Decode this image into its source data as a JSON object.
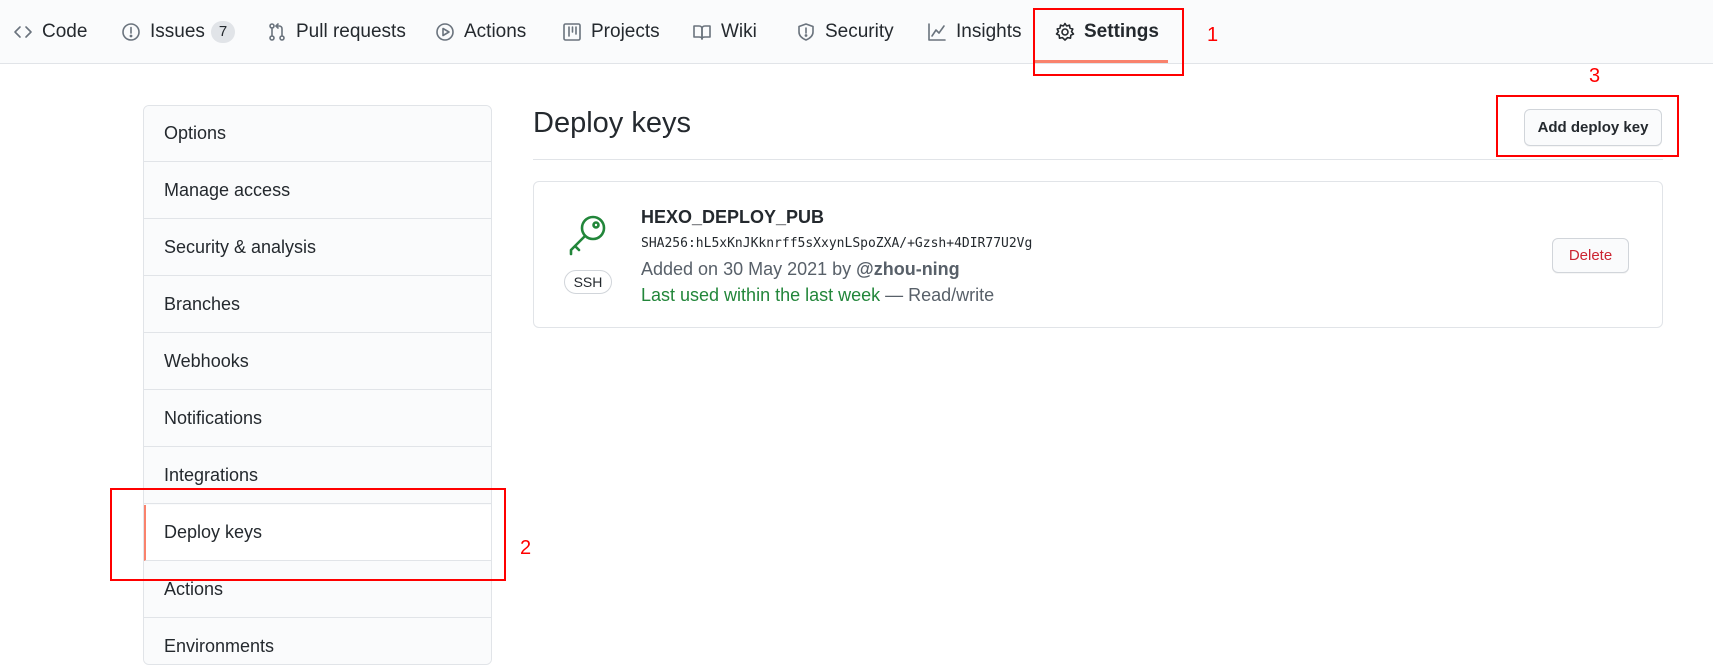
{
  "nav": {
    "tabs": [
      {
        "label": "Code",
        "icon": "code-icon"
      },
      {
        "label": "Issues",
        "icon": "issue-icon",
        "count": "7"
      },
      {
        "label": "Pull requests",
        "icon": "pull-request-icon"
      },
      {
        "label": "Actions",
        "icon": "play-icon"
      },
      {
        "label": "Projects",
        "icon": "project-icon"
      },
      {
        "label": "Wiki",
        "icon": "book-icon"
      },
      {
        "label": "Security",
        "icon": "shield-icon"
      },
      {
        "label": "Insights",
        "icon": "graph-icon"
      },
      {
        "label": "Settings",
        "icon": "gear-icon",
        "selected": true
      }
    ]
  },
  "sidebar": {
    "items": [
      {
        "label": "Options"
      },
      {
        "label": "Manage access"
      },
      {
        "label": "Security & analysis"
      },
      {
        "label": "Branches"
      },
      {
        "label": "Webhooks"
      },
      {
        "label": "Notifications"
      },
      {
        "label": "Integrations"
      },
      {
        "label": "Deploy keys",
        "selected": true
      },
      {
        "label": "Actions"
      },
      {
        "label": "Environments"
      }
    ]
  },
  "main": {
    "title": "Deploy keys",
    "add_button": "Add deploy key",
    "key": {
      "badge": "SSH",
      "name": "HEXO_DEPLOY_PUB",
      "fingerprint": "SHA256:hL5xKnJKknrff5sXxynLSpoZXA/+Gzsh+4DIR77U2Vg",
      "added_prefix": "Added on 30 May 2021 by ",
      "added_by": "@zhou-ning",
      "last_used": "Last used within the last week",
      "access": " — Read/write",
      "delete_button": "Delete"
    }
  },
  "annotations": {
    "labels": [
      "1",
      "2",
      "3"
    ],
    "color": "#ff0000"
  },
  "colors": {
    "accent_underline": "#f9826c",
    "success_green": "#22863a",
    "danger_red": "#cb2431"
  }
}
